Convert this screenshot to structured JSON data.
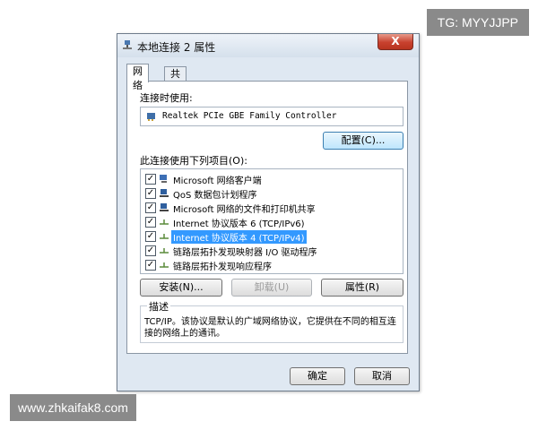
{
  "watermarks": {
    "top_right": "TG: MYYJJPP",
    "bottom_left": "www.zhkaifak8.com"
  },
  "dialog": {
    "title": "本地连接 2 属性",
    "close_label": "X",
    "tabs": [
      {
        "label": "网络",
        "active": true
      },
      {
        "label": "共享",
        "active": false
      }
    ],
    "connect_using_label": "连接时使用:",
    "adapter_name": "Realtek PCIe GBE Family Controller",
    "configure_label": "配置(C)...",
    "items_label": "此连接使用下列项目(O):",
    "items": [
      {
        "label": "Microsoft 网络客户端",
        "checked": true,
        "icon": "network-client-icon"
      },
      {
        "label": "QoS 数据包计划程序",
        "checked": true,
        "icon": "qos-icon"
      },
      {
        "label": "Microsoft 网络的文件和打印机共享",
        "checked": true,
        "icon": "file-printer-sharing-icon"
      },
      {
        "label": "Internet 协议版本 6 (TCP/IPv6)",
        "checked": true,
        "icon": "protocol-icon"
      },
      {
        "label": "Internet 协议版本 4 (TCP/IPv4)",
        "checked": true,
        "icon": "protocol-icon",
        "selected": true
      },
      {
        "label": "链路层拓扑发现映射器 I/O 驱动程序",
        "checked": true,
        "icon": "protocol-icon"
      },
      {
        "label": "链路层拓扑发现响应程序",
        "checked": true,
        "icon": "protocol-icon"
      }
    ],
    "install_label": "安装(N)...",
    "uninstall_label": "卸载(U)",
    "properties_label": "属性(R)",
    "description_title": "描述",
    "description_text": "TCP/IP。该协议是默认的广域网络协议，它提供在不同的相互连接的网络上的通讯。",
    "ok_label": "确定",
    "cancel_label": "取消",
    "colors": {
      "selection": "#3399ff",
      "frame": "#dfe8f2",
      "close": "#c8412e"
    }
  }
}
